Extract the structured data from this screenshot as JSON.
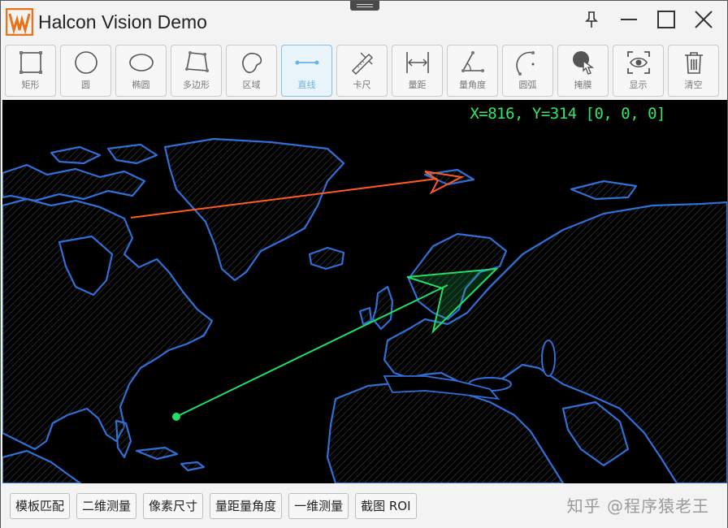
{
  "window": {
    "title": "Halcon Vision Demo",
    "controls": [
      "pin-icon",
      "minimize-icon",
      "maximize-icon",
      "close-icon"
    ]
  },
  "toolbar": {
    "tools": [
      {
        "label": "矩形",
        "icon": "rectangle-icon"
      },
      {
        "label": "圆",
        "icon": "circle-icon"
      },
      {
        "label": "椭圆",
        "icon": "ellipse-icon"
      },
      {
        "label": "多边形",
        "icon": "polygon-icon"
      },
      {
        "label": "区域",
        "icon": "region-icon"
      },
      {
        "label": "直线",
        "icon": "line-icon",
        "active": true
      },
      {
        "label": "卡尺",
        "icon": "caliper-icon"
      },
      {
        "label": "量距",
        "icon": "distance-icon"
      },
      {
        "label": "量角度",
        "icon": "angle-icon"
      },
      {
        "label": "圆弧",
        "icon": "arc-icon"
      },
      {
        "label": "掩膜",
        "icon": "mask-icon"
      },
      {
        "label": "显示",
        "icon": "eye-icon"
      },
      {
        "label": "清空",
        "icon": "trash-icon"
      }
    ]
  },
  "canvas": {
    "coord_readout": "X=816, Y=314  [0, 0, 0]",
    "colors": {
      "coastline": "#2f6fd6",
      "orange_arrow": "#ff5a1f",
      "green_arrow": "#22dd66"
    }
  },
  "bottom": {
    "buttons": [
      "模板匹配",
      "二维测量",
      "像素尺寸",
      "量距量角度",
      "一维测量",
      "截图 ROI"
    ],
    "watermark": "知乎 @程序猿老王"
  }
}
